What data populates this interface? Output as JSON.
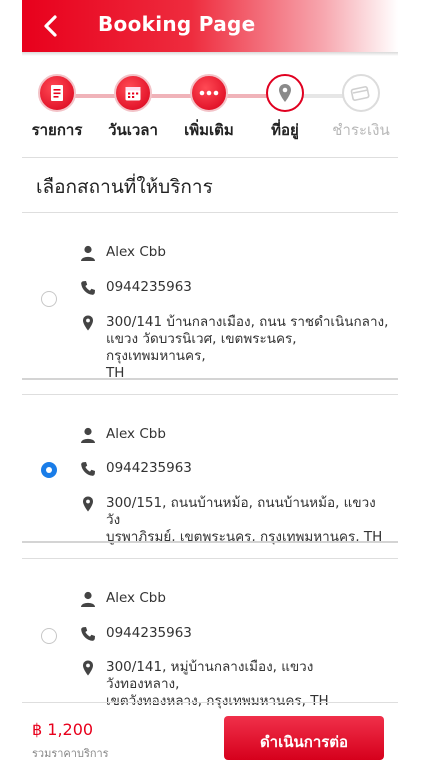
{
  "header": {
    "title": "Booking Page"
  },
  "steps": [
    {
      "label": "รายการ",
      "icon": "document-icon",
      "state": "done"
    },
    {
      "label": "วันเวลา",
      "icon": "calendar-icon",
      "state": "done"
    },
    {
      "label": "เพิ่มเติม",
      "icon": "more-icon",
      "state": "done"
    },
    {
      "label": "ที่อยู่",
      "icon": "location-pin-icon",
      "state": "active"
    },
    {
      "label": "ชำระเงิน",
      "icon": "payment-card-icon",
      "state": "todo"
    }
  ],
  "section_title": "เลือกสถานที่ให้บริการ",
  "addresses": [
    {
      "name": "Alex Cbb",
      "phone": "0944235963",
      "address_lines": [
        "300/141 บ้านกลางเมือง, ถนน ราชดำเนินกลาง,",
        "แขวง วัดบวรนิเวศ, เขตพระนคร, กรุงเทพมหานคร,",
        "TH"
      ],
      "selected": false
    },
    {
      "name": "Alex Cbb",
      "phone": "0944235963",
      "address_lines": [
        "300/151, ถนนบ้านหม้อ, ถนนบ้านหม้อ, แขวง วัง",
        "บูรพาภิรมย์, เขตพระนคร, กรุงเทพมหานคร, TH"
      ],
      "selected": true
    },
    {
      "name": "Alex Cbb",
      "phone": "0944235963",
      "address_lines": [
        "300/141, หมู่บ้านกลางเมือง, แขวง วังทองหลาง,",
        "เขตวังทองหลาง, กรุงเทพมหานคร, TH"
      ],
      "selected": false
    }
  ],
  "footer": {
    "price": "฿ 1,200",
    "price_sub": "รวมราคาบริการ",
    "continue_label": "ดำเนินการต่อ"
  },
  "colors": {
    "accent": "#e8001c",
    "radio_selected": "#1a7de8"
  }
}
